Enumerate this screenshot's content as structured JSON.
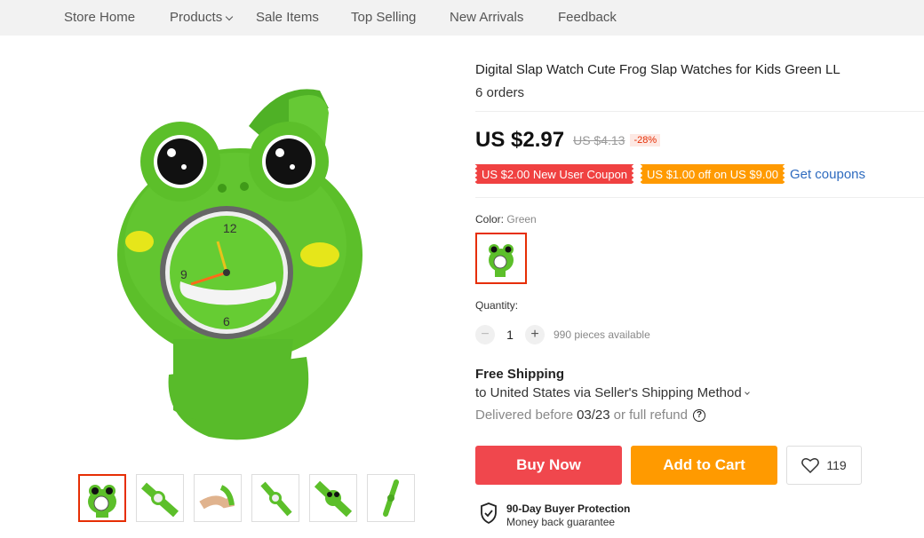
{
  "nav": {
    "items": [
      "Store Home",
      "Products",
      "Sale Items",
      "Top Selling",
      "New Arrivals",
      "Feedback"
    ]
  },
  "product": {
    "title": "Digital Slap Watch Cute Frog Slap Watches for Kids Green LL",
    "orders": "6 orders",
    "price": "US $2.97",
    "old_price": "US $4.13",
    "discount": "-28%",
    "coupons": [
      "US $2.00 New User Coupon",
      "US $1.00 off on US $9.00"
    ],
    "get_coupons": "Get coupons",
    "color_label": "Color:",
    "color_value": "Green",
    "quantity_label": "Quantity:",
    "quantity": "1",
    "minus": "−",
    "plus": "+",
    "available": "990 pieces available",
    "shipping_title": "Free Shipping",
    "shipping_method": "to United States via Seller's Shipping Method",
    "delivered_prefix": "Delivered before",
    "delivered_date": "03/23",
    "delivered_suffix": "or full refund",
    "help": "?",
    "buy_now": "Buy Now",
    "add_to_cart": "Add to Cart",
    "wishlist_count": "119",
    "protection_title": "90-Day Buyer Protection",
    "protection_sub": "Money back guarantee"
  },
  "colors": {
    "accent_red": "#f0474d",
    "accent_orange": "#ff9a00",
    "link_blue": "#2e6bbf",
    "frog_green": "#5cbf2a"
  },
  "icons": [
    "chevron-down-icon",
    "question-icon",
    "heart-icon",
    "shield-check-icon"
  ]
}
